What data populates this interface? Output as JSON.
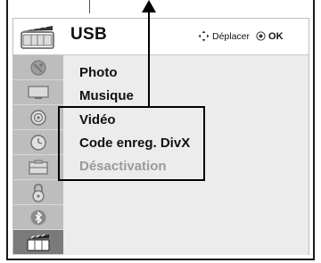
{
  "header": {
    "title": "USB",
    "icon": "usb-film-icon"
  },
  "nav_hint": {
    "move_label": "Déplacer",
    "ok_label": "OK",
    "move_icon": "dpad-icon",
    "ok_icon": "ok-button-icon"
  },
  "side_icons": [
    {
      "name": "satellite-dish-icon",
      "active": false
    },
    {
      "name": "tv-screen-icon",
      "active": false
    },
    {
      "name": "speaker-icon",
      "active": false
    },
    {
      "name": "clock-icon",
      "active": false
    },
    {
      "name": "options-icon",
      "active": false
    },
    {
      "name": "lock-icon",
      "active": false
    },
    {
      "name": "bluetooth-icon",
      "active": false
    },
    {
      "name": "usb-film-icon",
      "active": true
    }
  ],
  "menu_items": [
    {
      "label": "Photo",
      "enabled": true
    },
    {
      "label": "Musique",
      "enabled": true
    },
    {
      "label": "Vidéo",
      "enabled": true
    },
    {
      "label": "Code enreg. DivX",
      "enabled": true
    },
    {
      "label": "Désactivation",
      "enabled": false
    }
  ],
  "colors": {
    "panel_bg": "#e9e9e9",
    "icon_column_bg": "#bdbdbd",
    "active_icon_bg": "#7a7a7a",
    "disabled_text": "#9a9a9a"
  }
}
